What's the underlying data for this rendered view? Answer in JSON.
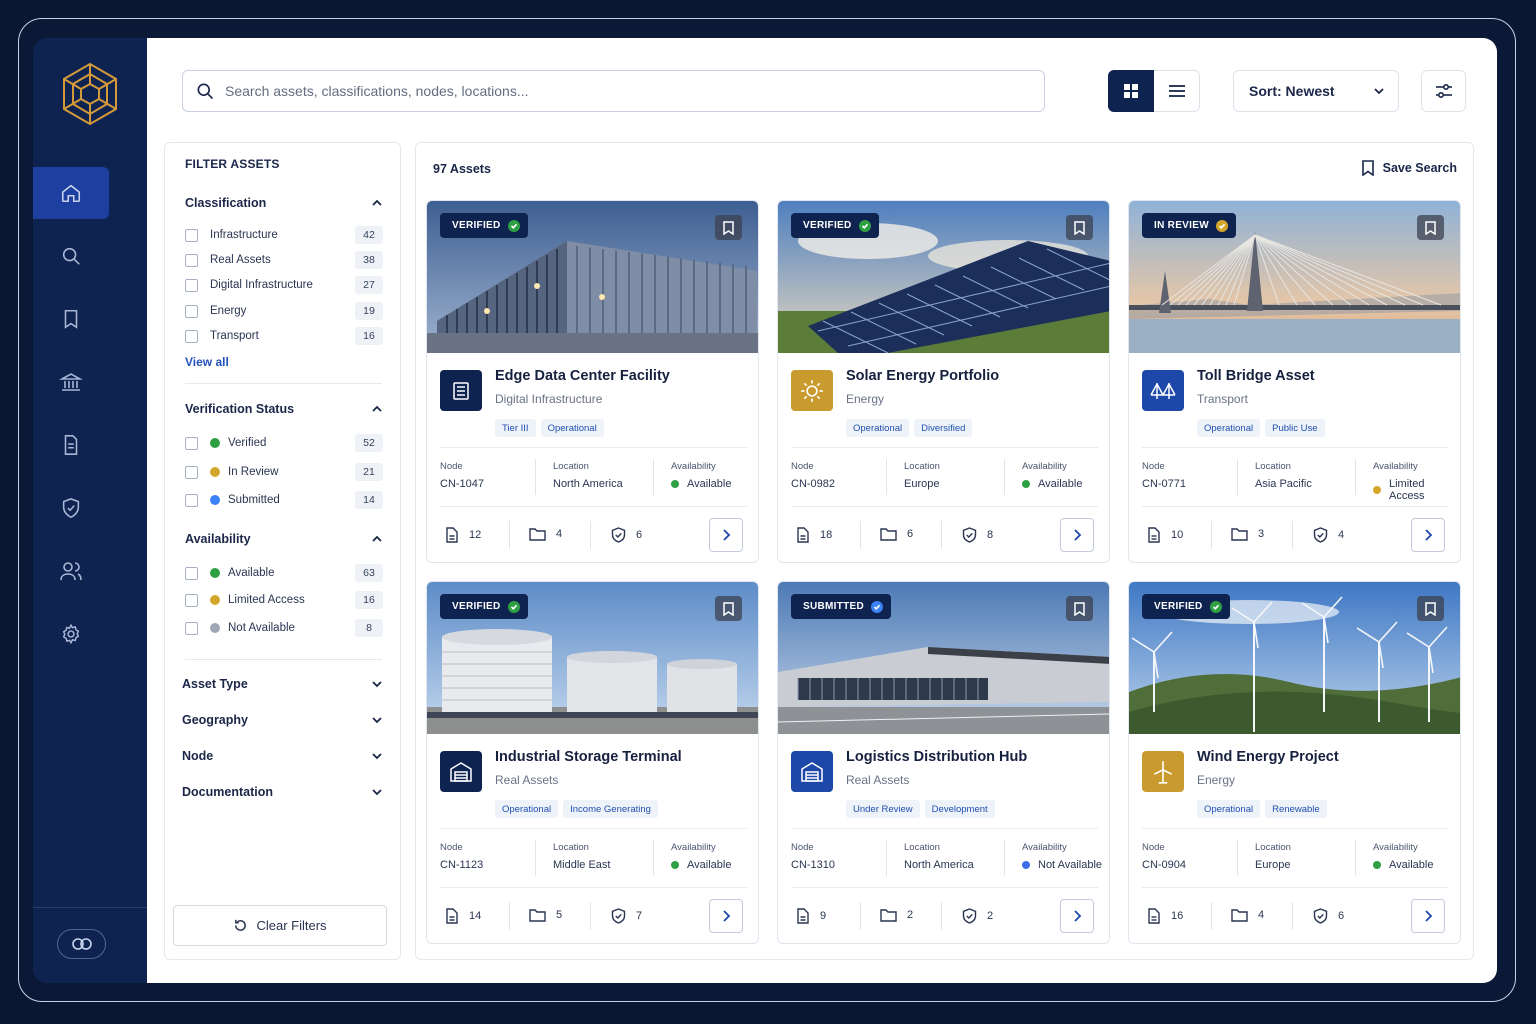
{
  "search": {
    "placeholder": "Search assets, classifications, nodes, locations..."
  },
  "sort": {
    "label": "Sort: Newest"
  },
  "filters": {
    "title": "FILTER ASSETS",
    "classification": {
      "title": "Classification",
      "items": [
        {
          "label": "Infrastructure",
          "count": "42"
        },
        {
          "label": "Real Assets",
          "count": "38"
        },
        {
          "label": "Digital Infrastructure",
          "count": "27"
        },
        {
          "label": "Energy",
          "count": "19"
        },
        {
          "label": "Transport",
          "count": "16"
        }
      ],
      "view_all": "View all"
    },
    "verification": {
      "title": "Verification Status",
      "items": [
        {
          "label": "Verified",
          "count": "52",
          "color": "#2ea043"
        },
        {
          "label": "In Review",
          "count": "21",
          "color": "#d4a72c"
        },
        {
          "label": "Submitted",
          "count": "14",
          "color": "#3b82f6"
        }
      ]
    },
    "availability": {
      "title": "Availability",
      "items": [
        {
          "label": "Available",
          "count": "63",
          "color": "#2ea043"
        },
        {
          "label": "Limited Access",
          "count": "16",
          "color": "#d4a72c"
        },
        {
          "label": "Not Available",
          "count": "8",
          "color": "#a0a6b4"
        }
      ]
    },
    "collapsed": [
      "Asset Type",
      "Geography",
      "Node",
      "Documentation"
    ],
    "clear_label": "Clear Filters"
  },
  "results": {
    "count_label": "97 Assets",
    "save_label": "Save Search",
    "meta_labels": {
      "node": "Node",
      "location": "Location",
      "availability": "Availability"
    },
    "cards": [
      {
        "status": "VERIFIED",
        "status_color": "#2ea043",
        "title": "Edge Data Center Facility",
        "category": "Digital Infrastructure",
        "tags": [
          "Tier III",
          "Operational"
        ],
        "node": "CN-1047",
        "location": "North America",
        "availability": "Available",
        "avail_color": "#2ea043",
        "docs": "12",
        "folders": "4",
        "checks": "6",
        "icon": "server-icon",
        "icon_bg": "#0f2350",
        "image": "datacenter"
      },
      {
        "status": "VERIFIED",
        "status_color": "#2ea043",
        "title": "Solar Energy Portfolio",
        "category": "Energy",
        "tags": [
          "Operational",
          "Diversified"
        ],
        "node": "CN-0982",
        "location": "Europe",
        "availability": "Available",
        "avail_color": "#2ea043",
        "docs": "18",
        "folders": "6",
        "checks": "8",
        "icon": "sun-icon",
        "icon_bg": "#c99a2e",
        "image": "solar"
      },
      {
        "status": "IN REVIEW",
        "status_color": "#d4a72c",
        "title": "Toll Bridge Asset",
        "category": "Transport",
        "tags": [
          "Operational",
          "Public Use"
        ],
        "node": "CN-0771",
        "location": "Asia Pacific",
        "availability": "Limited Access",
        "avail_color": "#d4a72c",
        "docs": "10",
        "folders": "3",
        "checks": "4",
        "icon": "bridge-icon",
        "icon_bg": "#1d47a8",
        "image": "bridge"
      },
      {
        "status": "VERIFIED",
        "status_color": "#2ea043",
        "title": "Industrial Storage Terminal",
        "category": "Real Assets",
        "tags": [
          "Operational",
          "Income Generating"
        ],
        "node": "CN-1123",
        "location": "Middle East",
        "availability": "Available",
        "avail_color": "#2ea043",
        "docs": "14",
        "folders": "5",
        "checks": "7",
        "icon": "warehouse-icon",
        "icon_bg": "#0f2350",
        "image": "tanks"
      },
      {
        "status": "SUBMITTED",
        "status_color": "#3b82f6",
        "title": "Logistics Distribution Hub",
        "category": "Real Assets",
        "tags": [
          "Under Review",
          "Development"
        ],
        "node": "CN-1310",
        "location": "North America",
        "availability": "Not Available",
        "avail_color": "#3b6ee8",
        "docs": "9",
        "folders": "2",
        "checks": "2",
        "icon": "warehouse-icon",
        "icon_bg": "#1d47a8",
        "image": "warehouse"
      },
      {
        "status": "VERIFIED",
        "status_color": "#2ea043",
        "title": "Wind Energy Project",
        "category": "Energy",
        "tags": [
          "Operational",
          "Renewable"
        ],
        "node": "CN-0904",
        "location": "Europe",
        "availability": "Available",
        "avail_color": "#2ea043",
        "docs": "16",
        "folders": "4",
        "checks": "6",
        "icon": "wind-turbine-icon",
        "icon_bg": "#c99a2e",
        "image": "wind"
      }
    ]
  }
}
